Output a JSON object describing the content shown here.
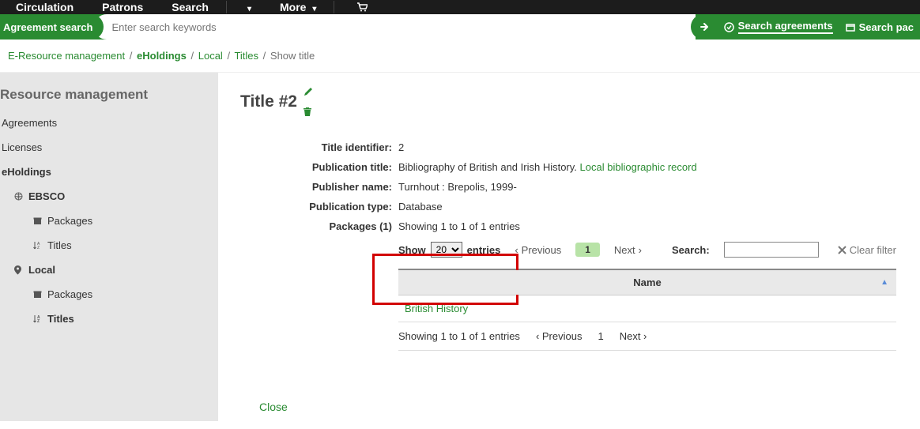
{
  "topnav": {
    "circulation": "Circulation",
    "patrons": "Patrons",
    "search": "Search",
    "more": "More"
  },
  "searchbar": {
    "label": "Agreement search",
    "placeholder": "Enter search keywords",
    "opt_agreements": "Search agreements",
    "opt_packages": "Search pac"
  },
  "breadcrumb": {
    "root": "E-Resource management",
    "eholdings": "eHoldings",
    "local": "Local",
    "titles": "Titles",
    "current": "Show title"
  },
  "sidebar": {
    "heading": "Resource management",
    "agreements": "Agreements",
    "licenses": "Licenses",
    "eholdings": "eHoldings",
    "ebsco": "EBSCO",
    "packages": "Packages",
    "titles": "Titles",
    "local": "Local"
  },
  "main": {
    "title": "Title #2",
    "fields": {
      "identifier_label": "Title identifier:",
      "identifier_value": "2",
      "pubtitle_label": "Publication title:",
      "pubtitle_value": "Bibliography of British and Irish History.",
      "pubtitle_link": "Local bibliographic record",
      "publisher_label": "Publisher name:",
      "publisher_value": "Turnhout : Brepolis, 1999-",
      "pubtype_label": "Publication type:",
      "pubtype_value": "Database",
      "packages_label": "Packages (1)"
    },
    "entries_info": "Showing 1 to 1 of 1 entries",
    "show_label": "Show",
    "show_value": "20",
    "entries_suffix": "entries",
    "previous": "Previous",
    "next": "Next",
    "page": "1",
    "search_label": "Search:",
    "clear_filter": "Clear filter",
    "table": {
      "col_name": "Name",
      "row0": "British History"
    },
    "close": "Close"
  }
}
